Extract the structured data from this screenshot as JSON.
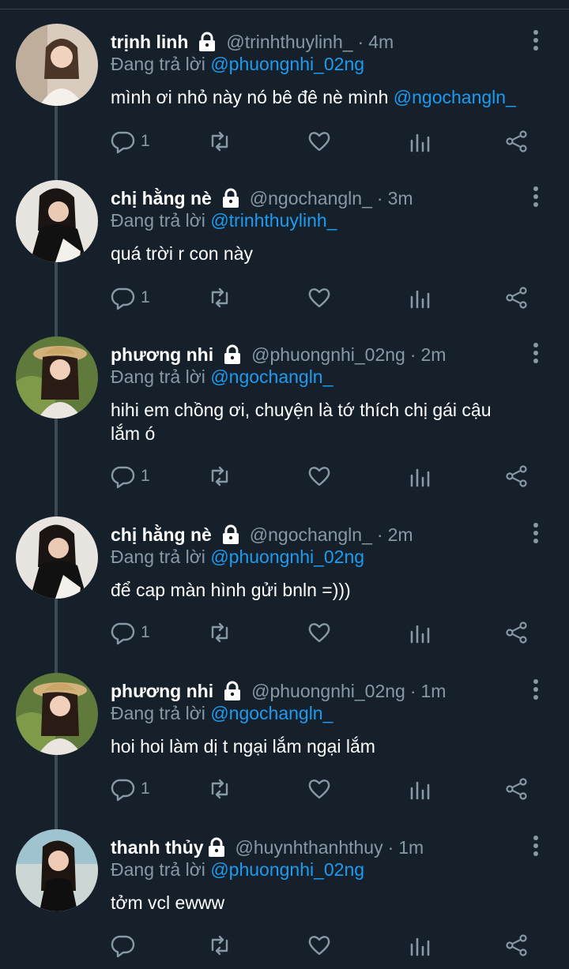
{
  "reply_prefix": "Đang trả lời",
  "tweets": [
    {
      "name": "trịnh linh",
      "handle": "@trinhthuylinh_",
      "time": "4m",
      "reply_to": "@phuongnhi_02ng",
      "text": "mình ơi nhỏ này nó bê đê nè mình ",
      "text_mention": "@ngochangln_",
      "text_line2": "",
      "reply_count": "1"
    },
    {
      "name": "chị hằng nè",
      "handle": "@ngochangln_",
      "time": "3m",
      "reply_to": "@trinhthuylinh_",
      "text": "quá trời r con này",
      "text_mention": "",
      "text_line2": "",
      "reply_count": "1"
    },
    {
      "name": "phương nhi",
      "handle": "@phuongnhi_02ng",
      "time": "2m",
      "reply_to": "@ngochangln_",
      "text": "hihi em chồng ơi, chuyện là tớ thích chị gái cậu",
      "text_mention": "",
      "text_line2": "lắm ó",
      "reply_count": "1"
    },
    {
      "name": "chị hằng nè",
      "handle": "@ngochangln_",
      "time": "2m",
      "reply_to": "@phuongnhi_02ng",
      "text": "để cap màn hình gửi bnln =)))",
      "text_mention": "",
      "text_line2": "",
      "reply_count": "1"
    },
    {
      "name": "phương nhi",
      "handle": "@phuongnhi_02ng",
      "time": "1m",
      "reply_to": "@ngochangln_",
      "text": "hoi hoi làm dị t ngại lắm ngại lắm",
      "text_mention": "",
      "text_line2": "",
      "reply_count": "1"
    },
    {
      "name": "thanh thủy",
      "handle": "@huynhthanhthuy",
      "time": "1m",
      "reply_to": "@phuongnhi_02ng",
      "text": "tởm vcl ewww",
      "text_mention": "",
      "text_line2": "",
      "reply_count": ""
    }
  ],
  "colors": {
    "background": "#15202b",
    "muted": "#8899a6",
    "accent": "#1d9bf0",
    "thread_line": "#3d4a55"
  },
  "icons": [
    "lock-icon",
    "more-icon",
    "reply-icon",
    "retweet-icon",
    "like-icon",
    "views-icon",
    "share-icon"
  ]
}
